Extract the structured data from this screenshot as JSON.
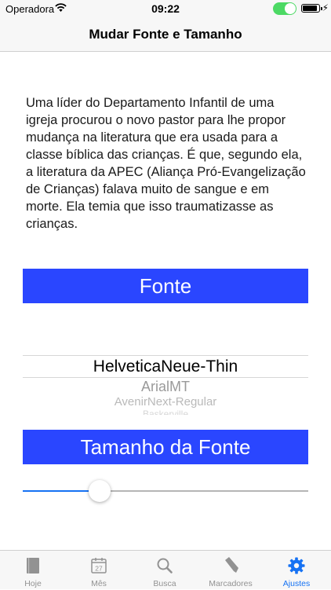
{
  "status_bar": {
    "carrier": "Operadora",
    "time": "09:22",
    "battery_level": 0.9
  },
  "nav": {
    "title": "Mudar Fonte e Tamanho"
  },
  "preview": {
    "text": "Uma líder do Departamento Infantil de uma igreja procurou o novo pastor para lhe propor mudança na literatura que era usada para a classe bíblica das crianças. É que, segundo ela, a  literatura da APEC (Aliança Pró-Evangelização de Crianças) falava muito de sangue e em morte. Ela temia que isso traumatizasse as crianças."
  },
  "font_section": {
    "header": "Fonte",
    "options": [
      "HelveticaNeue-Thin",
      "ArialMT",
      "AvenirNext-Regular",
      "Baskerville"
    ],
    "selected": "HelveticaNeue-Thin"
  },
  "size_section": {
    "header": "Tamanho da Fonte",
    "slider_value": 0.23
  },
  "colors": {
    "header_blue": "#2a46ff",
    "tint": "#1672f3",
    "inactive_tab": "#929292"
  },
  "tabs": [
    {
      "label": "Hoje",
      "icon": "book-icon"
    },
    {
      "label": "Mês",
      "icon": "calendar-icon",
      "day": "27"
    },
    {
      "label": "Busca",
      "icon": "search-icon"
    },
    {
      "label": "Marcadores",
      "icon": "bookmark-icon"
    },
    {
      "label": "Ajustes",
      "icon": "gear-icon",
      "active": true
    }
  ]
}
